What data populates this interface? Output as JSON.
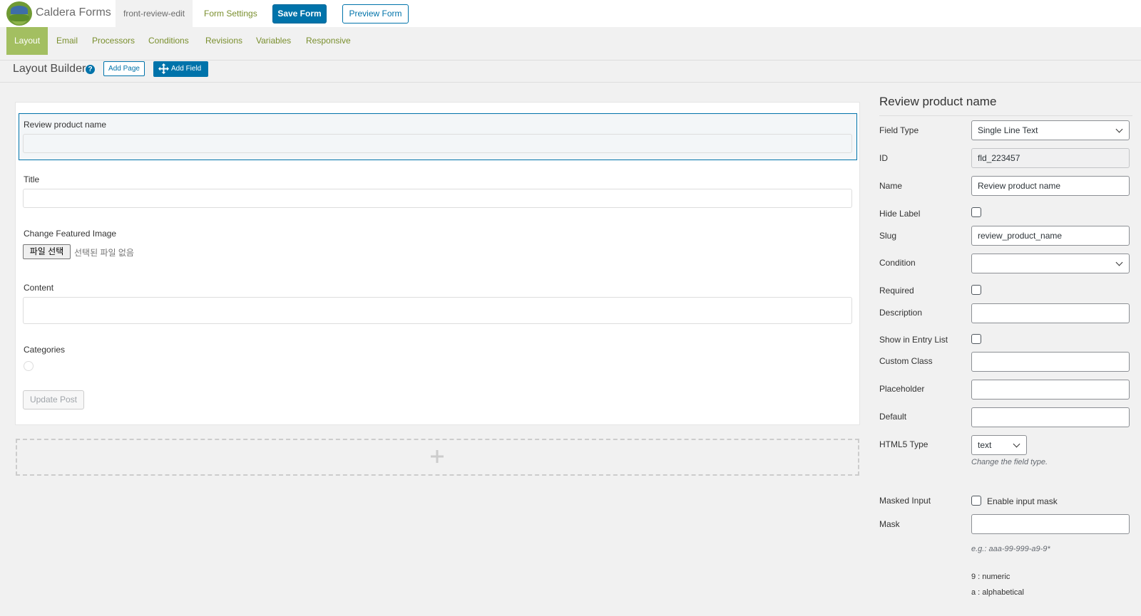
{
  "header": {
    "brand": "Caldera Forms",
    "form_slug": "front-review-edit",
    "form_settings": "Form Settings",
    "save_label": "Save Form",
    "preview_label": "Preview Form"
  },
  "tabs": [
    "Layout",
    "Email",
    "Processors",
    "Conditions",
    "Revisions",
    "Variables",
    "Responsive"
  ],
  "builder": {
    "title": "Layout Builder",
    "help": "?",
    "add_page": "Add Page",
    "add_field": "Add Field"
  },
  "form": {
    "fields": [
      {
        "label": "Review product name"
      },
      {
        "label": "Title"
      },
      {
        "label": "Change Featured Image"
      },
      {
        "label": "Content"
      },
      {
        "label": "Categories"
      }
    ],
    "file_button": "파일 선택",
    "file_none": "선택된 파일 없음",
    "update_button": "Update Post"
  },
  "panel": {
    "title": "Review product name",
    "field_type_label": "Field Type",
    "field_type_value": "Single Line Text",
    "id_label": "ID",
    "id_value": "fld_223457",
    "name_label": "Name",
    "name_value": "Review product name",
    "hide_label": "Hide Label",
    "slug_label": "Slug",
    "slug_value": "review_product_name",
    "condition_label": "Condition",
    "required_label": "Required",
    "description_label": "Description",
    "show_entry_label": "Show in Entry List",
    "custom_class_label": "Custom Class",
    "placeholder_label": "Placeholder",
    "default_label": "Default",
    "html5_label": "HTML5 Type",
    "html5_value": "text",
    "html5_note": "Change the field type.",
    "masked_label": "Masked Input",
    "mask_enable": "Enable input mask",
    "mask_label": "Mask",
    "mask_example": "e.g.: aaa-99-999-a9-9*",
    "mask_numeric": "9 : numeric",
    "mask_alpha": "a : alphabetical"
  }
}
